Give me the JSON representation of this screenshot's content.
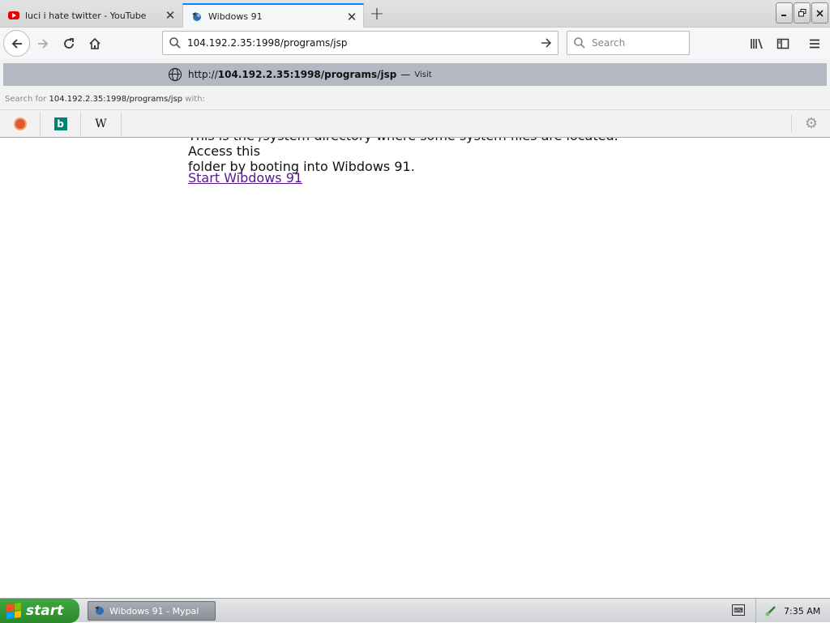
{
  "tabs": [
    {
      "title": "luci i hate twitter - YouTube",
      "favicon": "youtube-icon",
      "active": false
    },
    {
      "title": "Wibdows 91",
      "favicon": "wibdows-icon",
      "active": true
    }
  ],
  "navbar": {
    "url": "104.192.2.35:1998/programs/jsp",
    "search_placeholder": "Search"
  },
  "dropdown": {
    "suggestion_prefix": "http://",
    "suggestion_bold": "104.192.2.35:1998/programs/jsp",
    "suggestion_dash": "—",
    "suggestion_action": "Visit",
    "search_for_label": "Search for",
    "search_for_term": "104.192.2.35:1998/programs/jsp",
    "search_for_suffix": "with:",
    "engines": [
      "duckduckgo-icon",
      "bing-icon",
      "wikipedia-icon"
    ],
    "wiki_letter": "W",
    "bing_letter": "b"
  },
  "page": {
    "text_line1": "This is the /system directory where some system files are located. Access this",
    "text_line2": "folder by booting into Wibdows 91.",
    "link": "Start Wibdows 91"
  },
  "taskbar": {
    "start_label": "start",
    "task_label": "Wibdows 91 - Mypal",
    "clock": "7:35 AM"
  },
  "colors": {
    "accent": "#0a84ff",
    "suggestion_highlight": "#b4b8c3",
    "link_visited": "#551a8b",
    "start_green": "#3fa83f"
  }
}
